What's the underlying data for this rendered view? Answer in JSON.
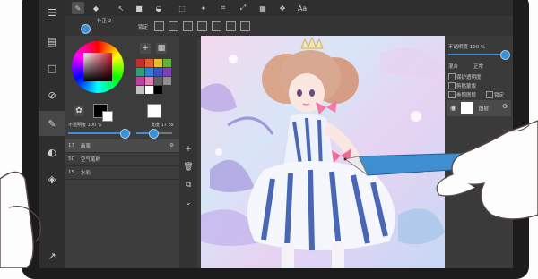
{
  "toolbar": {
    "items": [
      {
        "icon": "pencil-icon",
        "active": true
      },
      {
        "icon": "eraser-icon"
      },
      {
        "icon": "select-arrow-icon"
      },
      {
        "icon": "fill-square-icon"
      },
      {
        "icon": "bucket-icon"
      },
      {
        "icon": "lasso-icon"
      },
      {
        "icon": "wand-icon"
      },
      {
        "icon": "crop-icon"
      },
      {
        "icon": "transform-icon"
      },
      {
        "icon": "grid-icon"
      },
      {
        "icon": "move-icon"
      },
      {
        "icon": "text-icon",
        "label": "Aa"
      }
    ]
  },
  "subbar": {
    "correction_label": "补正 2",
    "lock_label": "锁定"
  },
  "brush_panel": {
    "opacity_label": "不透明度 100 %",
    "size_label": "宽度 17 px",
    "add_label": "+",
    "brushes": [
      {
        "num": "17",
        "name": "画笔",
        "selected": true
      },
      {
        "num": "50",
        "name": "空气笔刷"
      },
      {
        "num": "15",
        "name": "水彩"
      }
    ],
    "swatch_colors": [
      "#c03030",
      "#e06030",
      "#e0c030",
      "#60b040",
      "#30a070",
      "#3080d0",
      "#4050c0",
      "#8040b0",
      "#c040a0",
      "#e080b0",
      "#606060",
      "#909090",
      "#c0c0c0",
      "#ffffff",
      "#000000"
    ]
  },
  "layer_panel": {
    "opacity_label": "不透明度 100 %",
    "blend_label": "混合",
    "blend_value": "正常",
    "protect_alpha": "保护透明度",
    "clipping": "剪贴蒙版",
    "ref_layer": "参照图层",
    "lock": "锁定",
    "layer_name": "图层"
  }
}
